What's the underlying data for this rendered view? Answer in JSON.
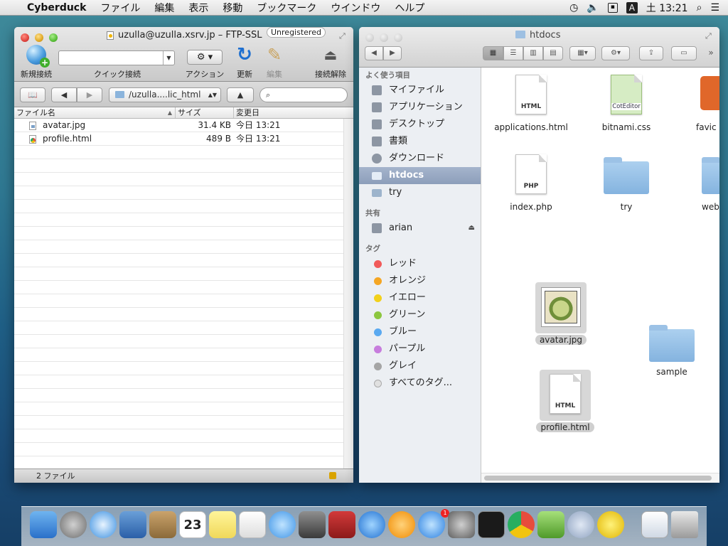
{
  "menubar": {
    "app_name": "Cyberduck",
    "items": [
      "ファイル",
      "編集",
      "表示",
      "移動",
      "ブックマーク",
      "ウインドウ",
      "ヘルプ"
    ],
    "input_indicator": "A",
    "clock": "土 13:21"
  },
  "cyberduck": {
    "title": "uzulla@uzulla.xsrv.jp – FTP-SSL",
    "badge": "Unregistered",
    "toolbar": {
      "new_connection": "新規接続",
      "quick_connect": "クイック接続",
      "action": "アクション",
      "refresh": "更新",
      "edit": "編集",
      "disconnect": "接続解除"
    },
    "path": "/uzulla....lic_html",
    "columns": {
      "name": "ファイル名",
      "size": "サイズ",
      "modified": "変更日"
    },
    "files": [
      {
        "name": "avatar.jpg",
        "size": "31.4 KB",
        "modified": "今日 13:21",
        "icon": "image-file-icon"
      },
      {
        "name": "profile.html",
        "size": "489 B",
        "modified": "今日 13:21",
        "icon": "html-file-icon"
      }
    ],
    "status": "2 ファイル"
  },
  "finder": {
    "title": "htdocs",
    "sidebar": {
      "favorites_header": "よく使う項目",
      "favorites": [
        {
          "label": "マイファイル",
          "icon": "all-my-files-icon"
        },
        {
          "label": "アプリケーション",
          "icon": "applications-icon"
        },
        {
          "label": "デスクトップ",
          "icon": "desktop-icon"
        },
        {
          "label": "書類",
          "icon": "documents-icon"
        },
        {
          "label": "ダウンロード",
          "icon": "downloads-icon"
        },
        {
          "label": "htdocs",
          "icon": "folder-icon"
        },
        {
          "label": "try",
          "icon": "folder-icon"
        }
      ],
      "shared_header": "共有",
      "shared": [
        {
          "label": "arian",
          "icon": "computer-icon"
        }
      ],
      "tags_header": "タグ",
      "tags": [
        {
          "label": "レッド",
          "color": "#f15a5a"
        },
        {
          "label": "オレンジ",
          "color": "#f5a623"
        },
        {
          "label": "イエロー",
          "color": "#f2d11b"
        },
        {
          "label": "グリーン",
          "color": "#8cc63f"
        },
        {
          "label": "ブルー",
          "color": "#5aa9f0"
        },
        {
          "label": "パープル",
          "color": "#c77ddd"
        },
        {
          "label": "グレイ",
          "color": "#a5a5a5"
        },
        {
          "label": "すべてのタグ...",
          "color": "#e0e0e0"
        }
      ]
    },
    "items": [
      {
        "name": "applications.html",
        "kind": "HTML"
      },
      {
        "name": "bitnami.css",
        "kind": "CotEditor"
      },
      {
        "name": "favic",
        "kind": "image"
      },
      {
        "name": "index.php",
        "kind": "PHP"
      },
      {
        "name": "try",
        "kind": "folder"
      },
      {
        "name": "web",
        "kind": "folder"
      },
      {
        "name": "avatar.jpg",
        "kind": "image"
      },
      {
        "name": "sample",
        "kind": "folder"
      },
      {
        "name": "profile.html",
        "kind": "HTML"
      }
    ]
  },
  "dock": {
    "apps": [
      "finder-icon",
      "launchpad-icon",
      "safari-icon",
      "mail-icon",
      "contacts-icon",
      "calendar-icon",
      "notes-icon",
      "reminders-icon",
      "messages-icon",
      "facetime-icon",
      "photo-booth-icon",
      "itunes-icon",
      "ibooks-icon",
      "app-store-icon",
      "system-preferences-icon",
      "terminal-icon",
      "chrome-icon",
      "coteditor-icon",
      "preferences-gear-icon",
      "cyberduck-icon",
      "documents-stack-icon",
      "trash-icon"
    ],
    "calendar_day": "23",
    "app_store_badge": "1"
  }
}
